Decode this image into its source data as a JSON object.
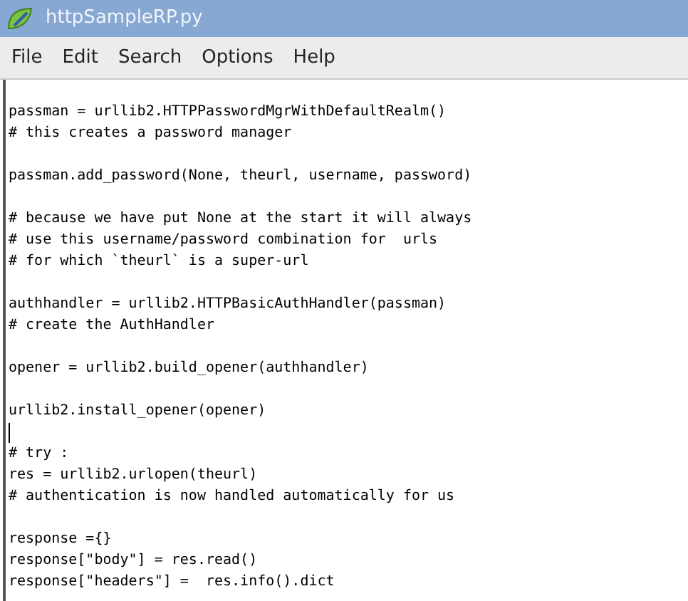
{
  "window": {
    "title": "httpSampleRP.py"
  },
  "menu": [
    {
      "label": "File"
    },
    {
      "label": "Edit"
    },
    {
      "label": "Search"
    },
    {
      "label": "Options"
    },
    {
      "label": "Help"
    }
  ],
  "editor": {
    "lines": [
      {
        "kind": "code",
        "text": "passman = urllib2.HTTPPasswordMgrWithDefaultRealm()",
        "cursor": false
      },
      {
        "kind": "code",
        "text": "# this creates a password manager",
        "cursor": false
      },
      {
        "kind": "blank",
        "cursor": false
      },
      {
        "kind": "code",
        "text": "passman.add_password(None, theurl, username, password)",
        "cursor": false
      },
      {
        "kind": "blank",
        "cursor": false
      },
      {
        "kind": "code",
        "text": "# because we have put None at the start it will always",
        "cursor": false
      },
      {
        "kind": "code",
        "text": "# use this username/password combination for  urls",
        "cursor": false
      },
      {
        "kind": "code",
        "text": "# for which `theurl` is a super-url",
        "cursor": false
      },
      {
        "kind": "blank",
        "cursor": false
      },
      {
        "kind": "code",
        "text": "authhandler = urllib2.HTTPBasicAuthHandler(passman)",
        "cursor": false
      },
      {
        "kind": "code",
        "text": "# create the AuthHandler",
        "cursor": false
      },
      {
        "kind": "blank",
        "cursor": false
      },
      {
        "kind": "code",
        "text": "opener = urllib2.build_opener(authhandler)",
        "cursor": false
      },
      {
        "kind": "blank",
        "cursor": false
      },
      {
        "kind": "code",
        "text": "urllib2.install_opener(opener)",
        "cursor": false
      },
      {
        "kind": "blank",
        "cursor": true
      },
      {
        "kind": "code",
        "text": "# try :",
        "cursor": false
      },
      {
        "kind": "code",
        "text": "res = urllib2.urlopen(theurl)",
        "cursor": false
      },
      {
        "kind": "code",
        "text": "# authentication is now handled automatically for us",
        "cursor": false
      },
      {
        "kind": "blank",
        "cursor": false
      },
      {
        "kind": "code",
        "text": "response ={}",
        "cursor": false
      },
      {
        "kind": "code",
        "text": "response[\"body\"] = res.read()",
        "cursor": false
      },
      {
        "kind": "code",
        "text": "response[\"headers\"] =  res.info().dict",
        "cursor": false
      }
    ]
  }
}
